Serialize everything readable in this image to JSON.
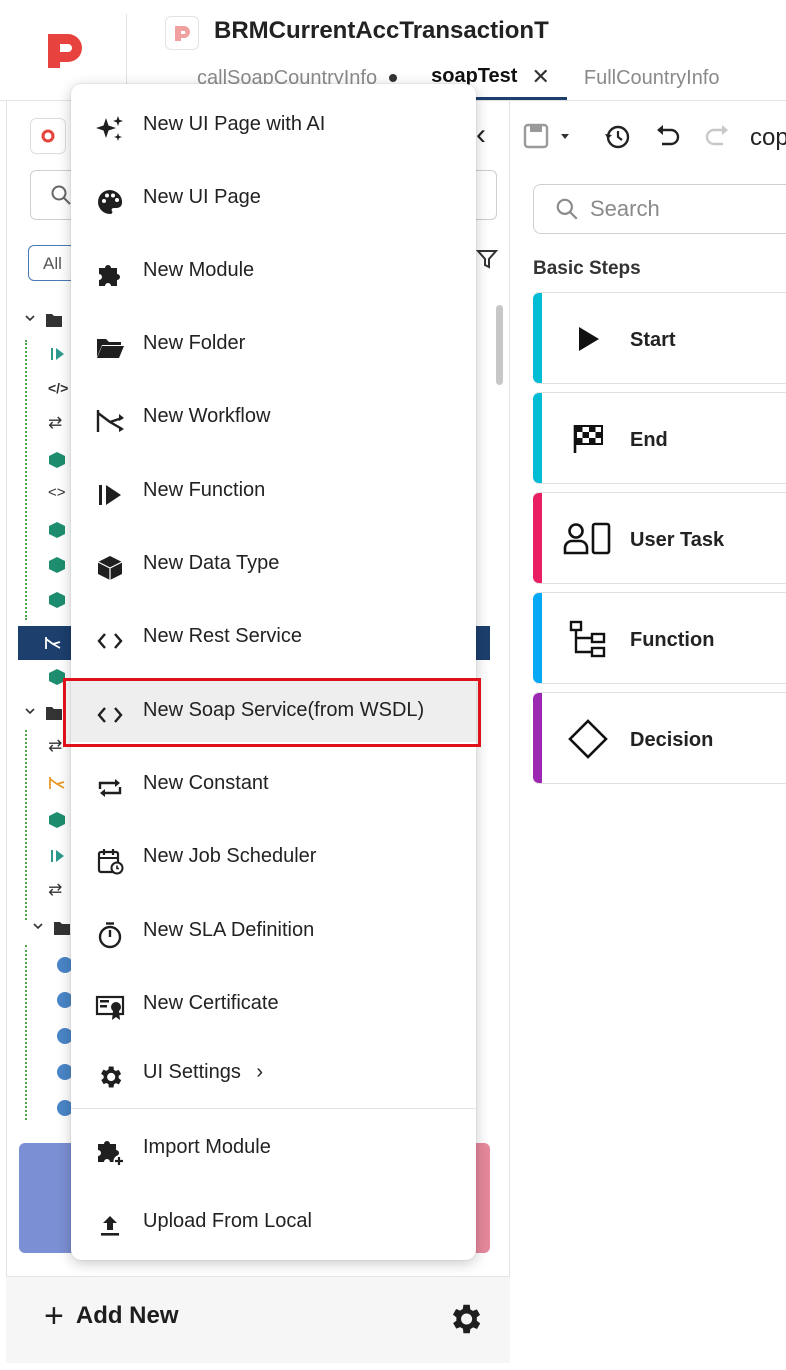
{
  "header": {
    "app_title": "BRMCurrentAccTransactionT",
    "tabs": [
      {
        "label": "callSoapCountryInfo",
        "unsaved": true
      },
      {
        "label": "soapTest",
        "active": true,
        "closable": true
      },
      {
        "label": "FullCountryInfo"
      }
    ]
  },
  "left_panel": {
    "filter_label": "All",
    "add_new_label": "Add New"
  },
  "toolbar": {
    "copy_label_partial": "cop"
  },
  "right_panel": {
    "search_placeholder": "Search",
    "section_title": "Basic Steps",
    "steps": [
      {
        "label": "Start",
        "color": "#00bcd4",
        "icon": "play-icon"
      },
      {
        "label": "End",
        "color": "#00bcd4",
        "icon": "checkered-flag-icon"
      },
      {
        "label": "User Task",
        "color": "#e91e63",
        "icon": "user-task-icon"
      },
      {
        "label": "Function",
        "color": "#03a9f4",
        "icon": "function-tree-icon"
      },
      {
        "label": "Decision",
        "color": "#9c27b0",
        "icon": "diamond-icon"
      }
    ]
  },
  "menu": {
    "items": [
      {
        "label": "New UI Page with AI",
        "icon": "sparkles-icon"
      },
      {
        "label": "New UI Page",
        "icon": "palette-icon"
      },
      {
        "label": "New Module",
        "icon": "puzzle-icon"
      },
      {
        "label": "New Folder",
        "icon": "folder-open-icon"
      },
      {
        "label": "New Workflow",
        "icon": "workflow-icon"
      },
      {
        "label": "New Function",
        "icon": "function-play-icon"
      },
      {
        "label": "New Data Type",
        "icon": "cube-icon"
      },
      {
        "label": "New Rest Service",
        "icon": "code-brackets-icon"
      },
      {
        "label": "New Soap Service(from WSDL)",
        "icon": "code-brackets-icon",
        "highlighted": true
      },
      {
        "label": "New Constant",
        "icon": "repeat-icon"
      },
      {
        "label": "New Job Scheduler",
        "icon": "calendar-clock-icon"
      },
      {
        "label": "New SLA Definition",
        "icon": "stopwatch-icon"
      },
      {
        "label": "New Certificate",
        "icon": "certificate-icon"
      },
      {
        "label": "UI Settings",
        "icon": "gear-icon",
        "has_submenu": true,
        "submenu_glyph": "›"
      },
      {
        "label": "Import Module",
        "icon": "puzzle-add-icon"
      },
      {
        "label": "Upload From Local",
        "icon": "upload-icon"
      }
    ]
  },
  "colors": {
    "brand_red": "#e8423f",
    "primary_navy": "#1c3f6e",
    "highlight_red": "#e0101a"
  }
}
